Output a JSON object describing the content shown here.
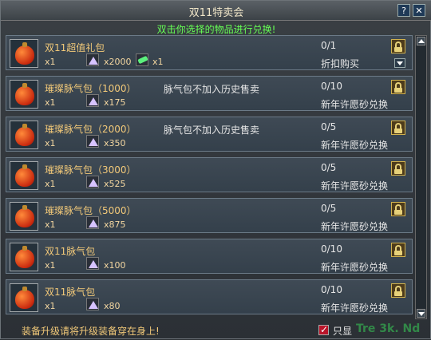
{
  "window": {
    "title": "双11特卖会",
    "help_label": "?",
    "close_label": "✕",
    "subtitle": "双击你选择的物品进行兑换!"
  },
  "items": [
    {
      "name": "双11超值礼包",
      "qty": "x1",
      "note": "",
      "count": "0/1",
      "action": "折扣购买",
      "cost_icon": "purple-crystal-icon",
      "cost_amount": "x2000",
      "extra_icon": "green-feather-icon",
      "extra_amount": "x1",
      "has_dropdown": true
    },
    {
      "name": "璀璨脉气包（1000）",
      "qty": "x1",
      "note": "脉气包不加入历史售卖",
      "count": "0/10",
      "action": "新年许愿砂兑换",
      "cost_icon": "purple-crystal-icon",
      "cost_amount": "x175"
    },
    {
      "name": "璀璨脉气包（2000）",
      "qty": "x1",
      "note": "脉气包不加入历史售卖",
      "count": "0/5",
      "action": "新年许愿砂兑换",
      "cost_icon": "purple-crystal-icon",
      "cost_amount": "x350"
    },
    {
      "name": "璀璨脉气包（3000）",
      "qty": "x1",
      "note": "",
      "count": "0/5",
      "action": "新年许愿砂兑换",
      "cost_icon": "purple-crystal-icon",
      "cost_amount": "x525"
    },
    {
      "name": "璀璨脉气包（5000）",
      "qty": "x1",
      "note": "",
      "count": "0/5",
      "action": "新年许愿砂兑换",
      "cost_icon": "purple-crystal-icon",
      "cost_amount": "x875"
    },
    {
      "name": "双11脉气包",
      "qty": "x1",
      "note": "",
      "count": "0/10",
      "action": "新年许愿砂兑换",
      "cost_icon": "purple-crystal-icon",
      "cost_amount": "x100"
    },
    {
      "name": "双11脉气包",
      "qty": "x1",
      "note": "",
      "count": "0/10",
      "action": "新年许愿砂兑换",
      "cost_icon": "purple-crystal-icon",
      "cost_amount": "x80"
    }
  ],
  "footer": {
    "tip": "装备升级请将升级装备穿在身上!",
    "show_label": "只显",
    "watermark": "Tre 3k. Nd"
  }
}
